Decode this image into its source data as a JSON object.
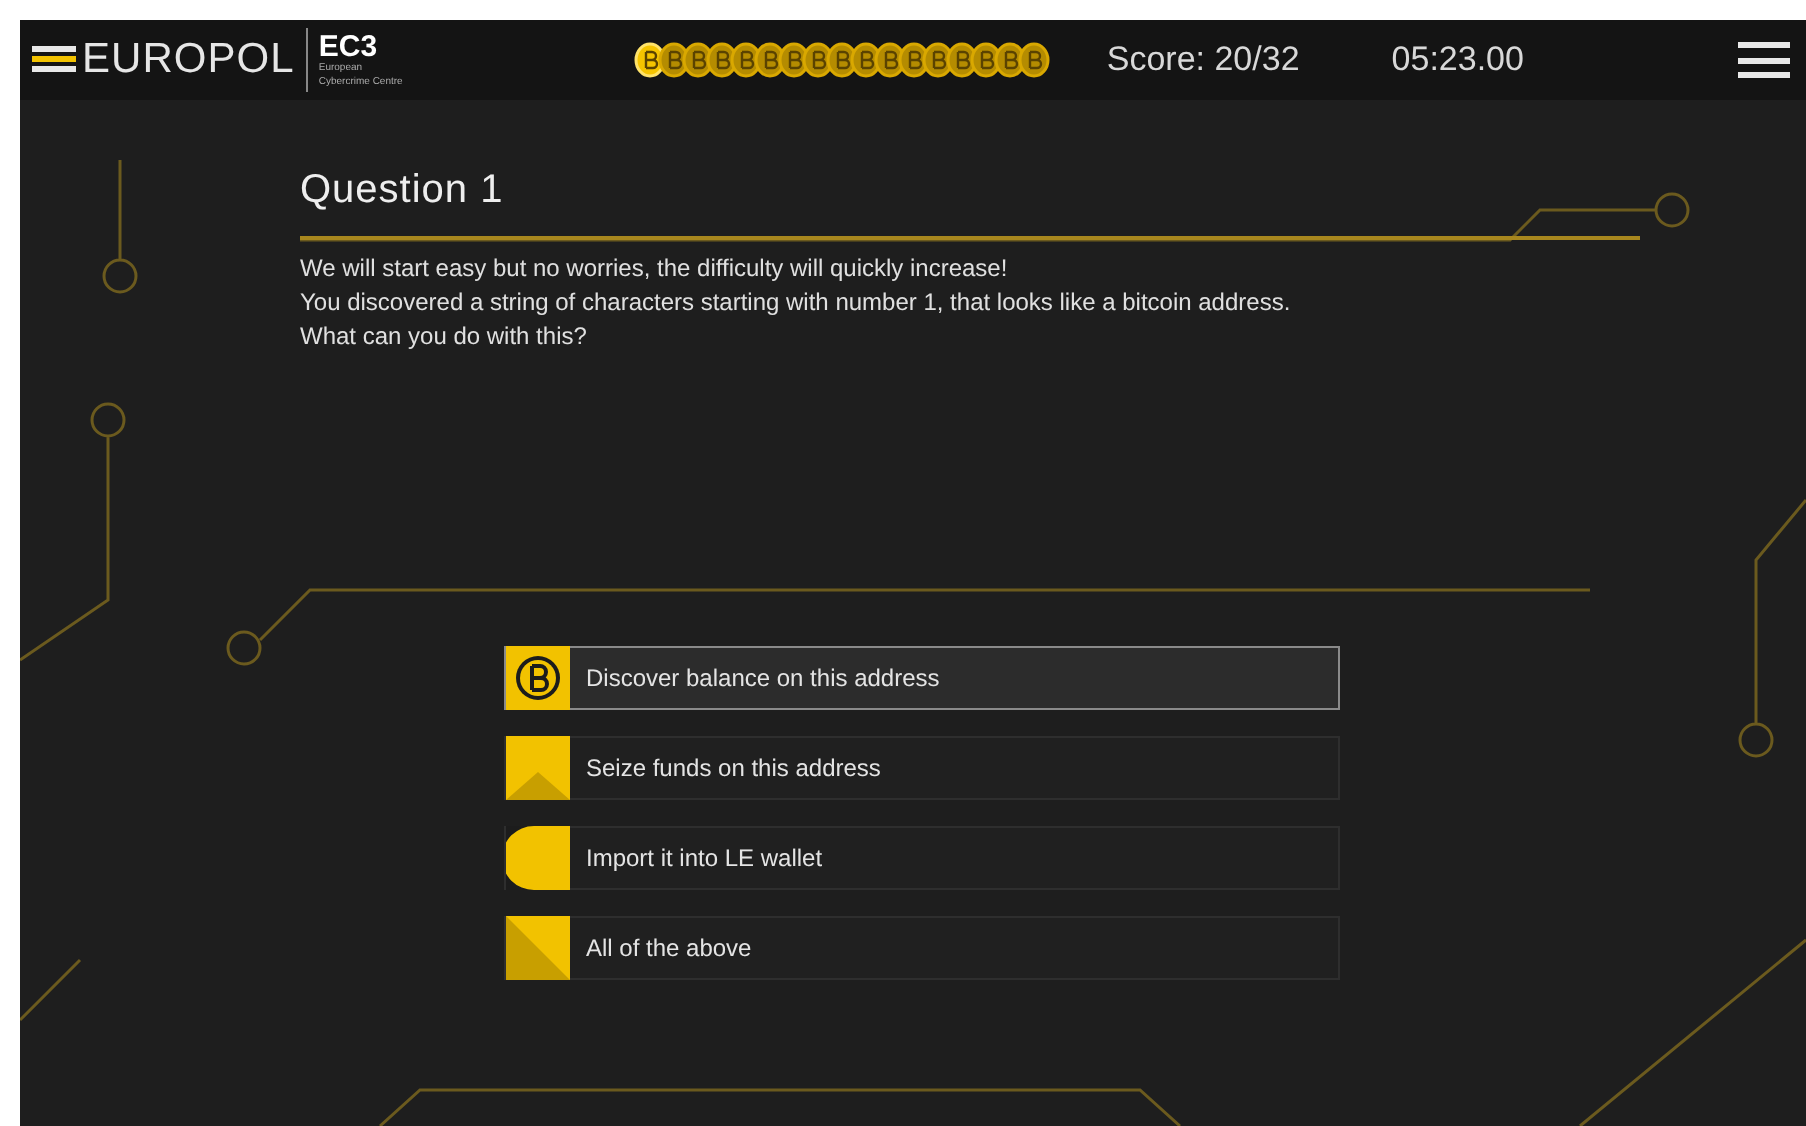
{
  "header": {
    "logo": "EUROPOL",
    "badge": "EC3",
    "badge_subtitle": "European Cybercrime Centre",
    "score": "Score: 20/32",
    "timer": "05:23.00"
  },
  "progress_coins": [
    {
      "current": true
    },
    {
      "current": false
    },
    {
      "current": false
    },
    {
      "current": false
    },
    {
      "current": false
    },
    {
      "current": false
    },
    {
      "current": false
    },
    {
      "current": false
    },
    {
      "current": false
    },
    {
      "current": false
    },
    {
      "current": false
    },
    {
      "current": false
    },
    {
      "current": false
    },
    {
      "current": false
    },
    {
      "current": false
    },
    {
      "current": false
    },
    {
      "current": false
    }
  ],
  "question": {
    "title": "Question 1",
    "lines": [
      "We will start easy but no worries, the difficulty will quickly increase!",
      "You discovered a string of characters starting with number 1, that looks like a bitcoin address.",
      "What can you do with this?"
    ]
  },
  "answers": [
    {
      "kind": "bitcoin",
      "label": "Discover balance on this address",
      "selected": true
    },
    {
      "kind": "triangle",
      "label": "Seize funds on this address",
      "selected": false
    },
    {
      "kind": "half",
      "label": "Import it into LE wallet",
      "selected": false
    },
    {
      "kind": "diagonal",
      "label": "All of the above",
      "selected": false
    }
  ]
}
